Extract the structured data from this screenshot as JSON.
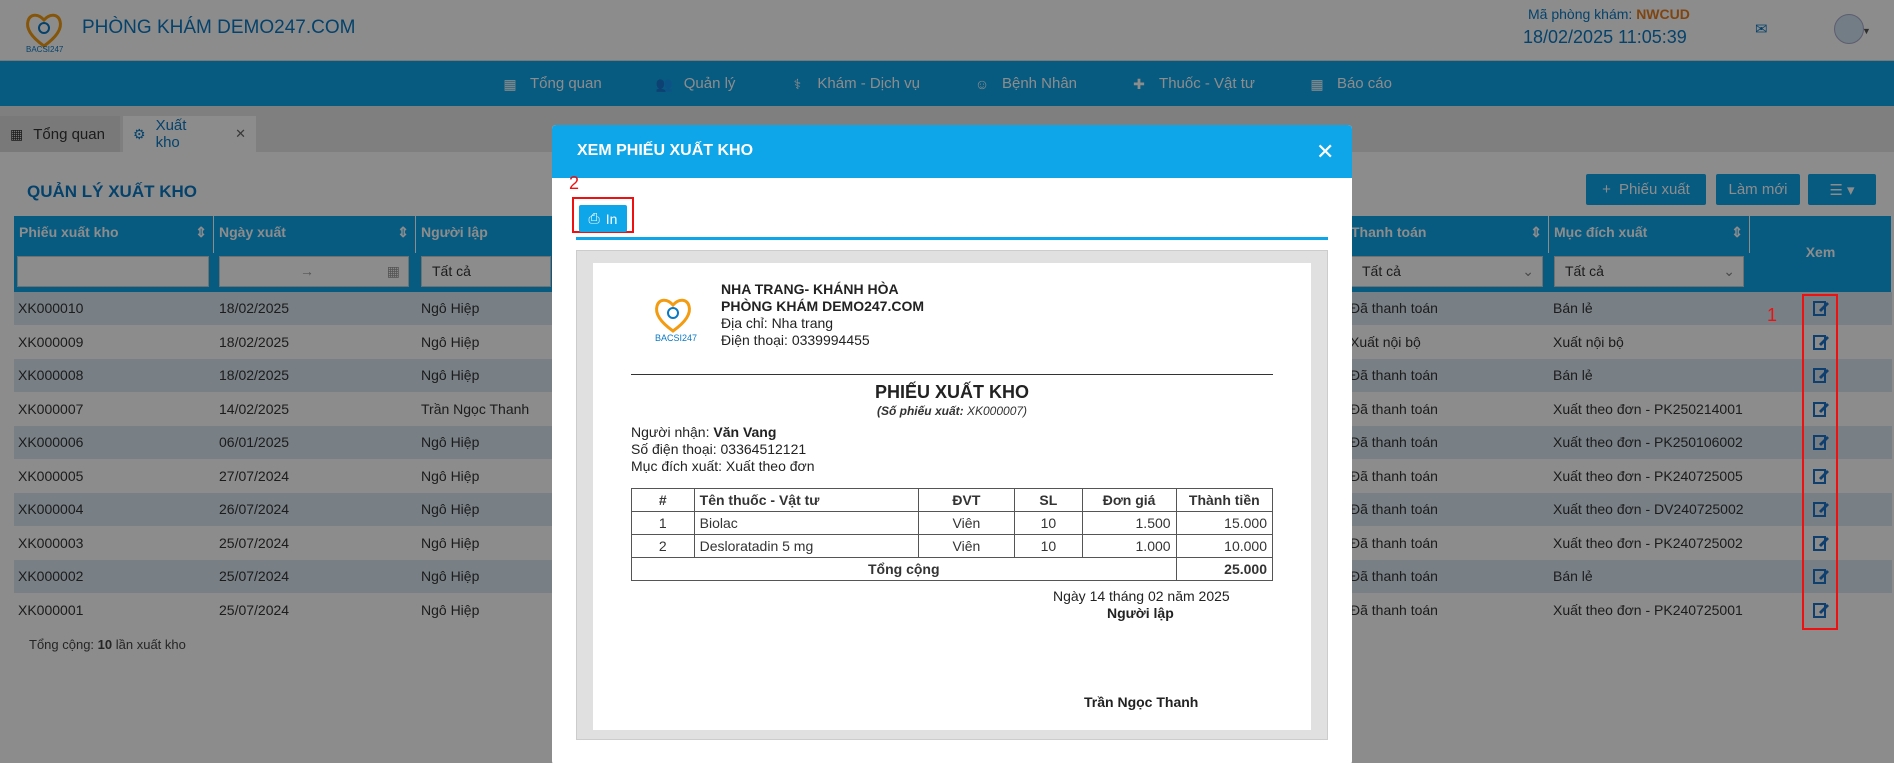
{
  "header": {
    "clinic_name": "PHÒNG KHÁM DEMO247.COM",
    "code_label": "Mã phòng khám:",
    "code_value": "NWCUD",
    "datetime": "18/02/2025 11:05:39"
  },
  "nav": {
    "items": [
      {
        "label": "Tổng quan",
        "icon": "dashboard-icon"
      },
      {
        "label": "Quản lý",
        "icon": "users-icon"
      },
      {
        "label": "Khám - Dịch vụ",
        "icon": "doctor-icon"
      },
      {
        "label": "Bệnh Nhân",
        "icon": "patient-icon"
      },
      {
        "label": "Thuốc - Vật tư",
        "icon": "pills-icon"
      },
      {
        "label": "Báo cáo",
        "icon": "report-icon"
      }
    ]
  },
  "tabs": [
    {
      "label": "Tổng quan"
    },
    {
      "label": "Xuất kho"
    }
  ],
  "page": {
    "title": "QUẢN LÝ XUẤT KHO",
    "btn_new_export": "Phiếu xuất",
    "btn_refresh": "Làm mới"
  },
  "table": {
    "columns": [
      "Phiếu xuất kho",
      "Ngày xuất",
      "Người lập",
      "Thanh toán",
      "Mục đích xuất",
      "Xem"
    ],
    "filters": {
      "nguoi_lap": "Tất cả",
      "thanh_toan": "Tất cả",
      "muc_dich": "Tất cả",
      "date_sep": "→"
    },
    "rows": [
      {
        "code": "XK000010",
        "date": "18/02/2025",
        "creator": "Ngô Hiệp",
        "payment": "Đã thanh toán",
        "purpose": "Bán lẻ"
      },
      {
        "code": "XK000009",
        "date": "18/02/2025",
        "creator": "Ngô Hiệp",
        "payment": "Xuất nội bộ",
        "purpose": "Xuất nội bộ"
      },
      {
        "code": "XK000008",
        "date": "18/02/2025",
        "creator": "Ngô Hiệp",
        "payment": "Đã thanh toán",
        "purpose": "Bán lẻ"
      },
      {
        "code": "XK000007",
        "date": "14/02/2025",
        "creator": "Trần Ngọc Thanh",
        "payment": "Đã thanh toán",
        "purpose": "Xuất theo đơn - PK250214001"
      },
      {
        "code": "XK000006",
        "date": "06/01/2025",
        "creator": "Ngô Hiệp",
        "payment": "Đã thanh toán",
        "purpose": "Xuất theo đơn - PK250106002"
      },
      {
        "code": "XK000005",
        "date": "27/07/2024",
        "creator": "Ngô Hiệp",
        "payment": "Đã thanh toán",
        "purpose": "Xuất theo đơn - PK240725005"
      },
      {
        "code": "XK000004",
        "date": "26/07/2024",
        "creator": "Ngô Hiệp",
        "payment": "Đã thanh toán",
        "purpose": "Xuất theo đơn - DV240725002"
      },
      {
        "code": "XK000003",
        "date": "25/07/2024",
        "creator": "Ngô Hiệp",
        "payment": "Đã thanh toán",
        "purpose": "Xuất theo đơn - PK240725002"
      },
      {
        "code": "XK000002",
        "date": "25/07/2024",
        "creator": "Ngô Hiệp",
        "payment": "Đã thanh toán",
        "purpose": "Bán lẻ"
      },
      {
        "code": "XK000001",
        "date": "25/07/2024",
        "creator": "Ngô Hiệp",
        "payment": "Đã thanh toán",
        "purpose": "Xuất theo đơn - PK240725001"
      }
    ],
    "total_prefix": "Tổng cộng:",
    "total_count": "10",
    "total_suffix": "lần xuất kho"
  },
  "annotations": {
    "step1": "1",
    "step2": "2"
  },
  "modal": {
    "title": "XEM PHIẾU XUẤT KHO",
    "print_label": "In",
    "doc": {
      "region": "NHA TRANG- KHÁNH HÒA",
      "clinic": "PHÒNG KHÁM DEMO247.COM",
      "address": "Địa chỉ: Nha trang",
      "phone": "Điện thoại: 0339994455",
      "title": "PHIẾU XUẤT KHO",
      "number_label": "(Số phiếu xuất:",
      "number_value": "XK000007)",
      "recipient_label": "Người nhận:",
      "recipient": "Văn Vang",
      "recipient_phone": "Số điện thoại: 03364512121",
      "purpose": "Mục đích xuất: Xuất theo đơn",
      "columns": [
        "#",
        "Tên thuốc - Vật tư",
        "ĐVT",
        "SL",
        "Đơn giá",
        "Thành tiền"
      ],
      "items": [
        {
          "no": "1",
          "name": "Biolac",
          "unit": "Viên",
          "qty": "10",
          "price": "1.500",
          "amount": "15.000"
        },
        {
          "no": "2",
          "name": "Desloratadin 5 mg",
          "unit": "Viên",
          "qty": "10",
          "price": "1.000",
          "amount": "10.000"
        }
      ],
      "total_label": "Tổng cộng",
      "total_value": "25.000",
      "date_line": "Ngày 14 tháng 02 năm 2025",
      "role": "Người lập",
      "signer": "Trần Ngọc Thanh"
    }
  },
  "colors": {
    "primary": "#0ea5e9",
    "accent": "#e67e22",
    "annotation": "#e11111"
  }
}
